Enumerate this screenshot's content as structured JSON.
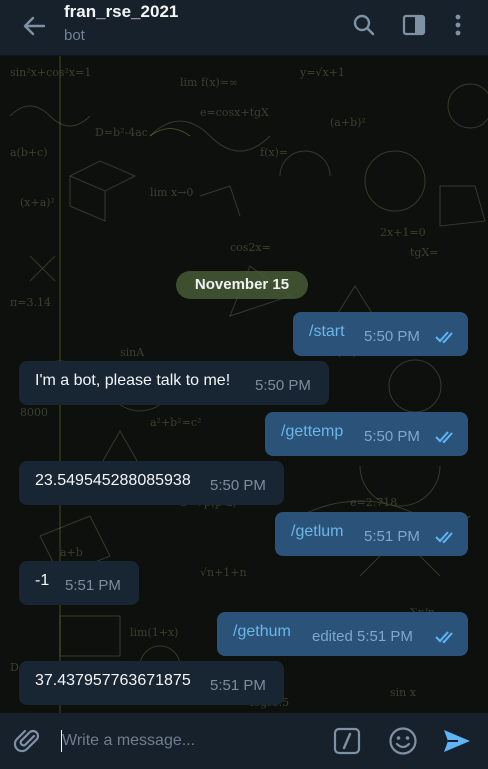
{
  "header": {
    "title": "fran_rse_2021",
    "subtitle": "bot"
  },
  "icons": {
    "back": "arrow-left-icon",
    "search": "search-icon",
    "sidebar": "sidebar-toggle-icon",
    "menu": "more-vertical-icon",
    "attach": "paperclip-icon",
    "commands": "slash-command-icon",
    "emoji": "emoji-icon",
    "send": "send-icon"
  },
  "chat": {
    "date": "November 15",
    "messages": [
      {
        "dir": "out",
        "text": "/start",
        "time": "5:50 PM"
      },
      {
        "dir": "in",
        "text": "I'm a bot, please talk to me!",
        "time": "5:50 PM"
      },
      {
        "dir": "out",
        "text": "/gettemp",
        "time": "5:50 PM"
      },
      {
        "dir": "in",
        "text": "23.549545288085938",
        "time": "5:50 PM"
      },
      {
        "dir": "out",
        "text": "/getlum",
        "time": "5:51 PM"
      },
      {
        "dir": "in",
        "text": "-1",
        "time": "5:51 PM"
      },
      {
        "dir": "out",
        "text": "/gethum",
        "time": "edited 5:51 PM"
      },
      {
        "dir": "in",
        "text": "37.437957763671875",
        "time": "5:51 PM"
      }
    ]
  },
  "composer": {
    "placeholder": "Write a message..."
  },
  "colors": {
    "header_bg": "#17212b",
    "outgoing_bubble": "#2b5278",
    "incoming_bubble": "#182533",
    "accent": "#5eb5f7",
    "date_pill": "#465a37"
  }
}
